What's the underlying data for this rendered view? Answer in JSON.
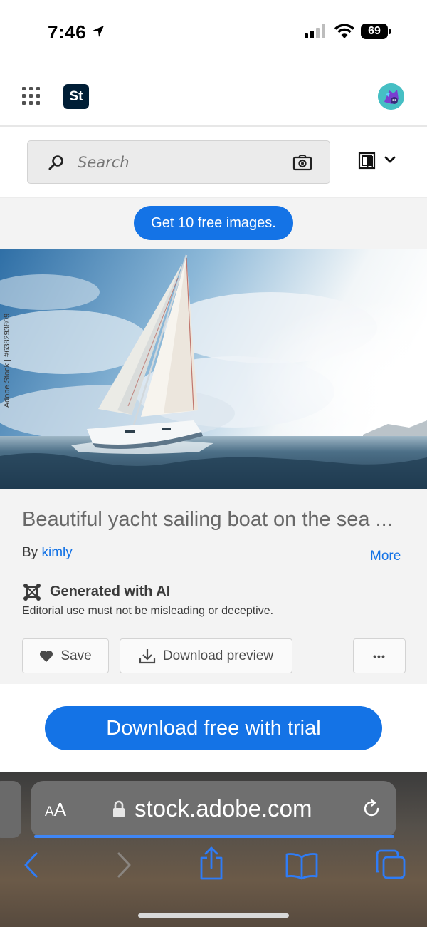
{
  "status_bar": {
    "time": "7:46",
    "battery": "69"
  },
  "header": {
    "app_logo": "St",
    "apps_icon": "apps-grid-icon",
    "avatar_icon": "avatar-icon"
  },
  "search": {
    "placeholder": "Search",
    "camera_icon": "camera-icon",
    "board_icon": "board-icon"
  },
  "promo": {
    "label": "Get 10 free images."
  },
  "hero": {
    "credit": "Adobe Stock | #638293809",
    "watermark": "Adobe Stock"
  },
  "asset": {
    "title": "Beautiful yacht sailing boat on the sea ...",
    "by_prefix": "By",
    "author": "kimly",
    "more": "More",
    "ai_label": "Generated with AI",
    "editorial_note": "Editorial use must not be misleading or deceptive.",
    "save_label": "Save",
    "download_preview_label": "Download preview",
    "more_menu": "•••"
  },
  "cta": {
    "label": "Download free with trial"
  },
  "browser": {
    "aa_small": "A",
    "aa_big": "A",
    "url": "stock.adobe.com"
  },
  "colors": {
    "accent": "#1473e6",
    "logo_bg": "#001e36"
  }
}
